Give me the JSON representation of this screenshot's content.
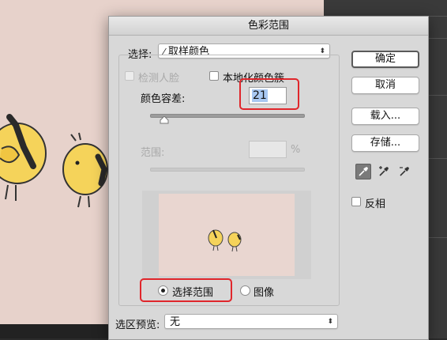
{
  "dialog": {
    "title": "色彩范围",
    "select_label": "选择:",
    "select_value": "取样颜色",
    "detect_faces_label": "检测人脸",
    "localized_clusters_label": "本地化颜色簇",
    "fuzziness_label": "颜色容差:",
    "fuzziness_value": "21",
    "range_label": "范围:",
    "range_value": "",
    "range_unit": "%",
    "view_selection_label": "选择范围",
    "view_image_label": "图像",
    "selection_preview_label": "选区预览:",
    "selection_preview_value": "无"
  },
  "buttons": {
    "ok": "确定",
    "cancel": "取消",
    "load": "载入...",
    "save": "存储..."
  },
  "invert_label": "反相",
  "state": {
    "fuzziness_slider_fraction": 0.1,
    "view_mode": "选择范围",
    "detect_faces_checked": false,
    "localized_clusters_checked": false,
    "invert_checked": false,
    "active_eyedropper": "eyedropper-icon"
  },
  "icons": [
    "eyedropper-icon",
    "eyedropper-plus-icon",
    "eyedropper-minus-icon"
  ],
  "colors": {
    "highlight_red": "#e0262b",
    "canvas_bg": "#e7d2cb",
    "chick_yellow": "#f5d35a"
  }
}
